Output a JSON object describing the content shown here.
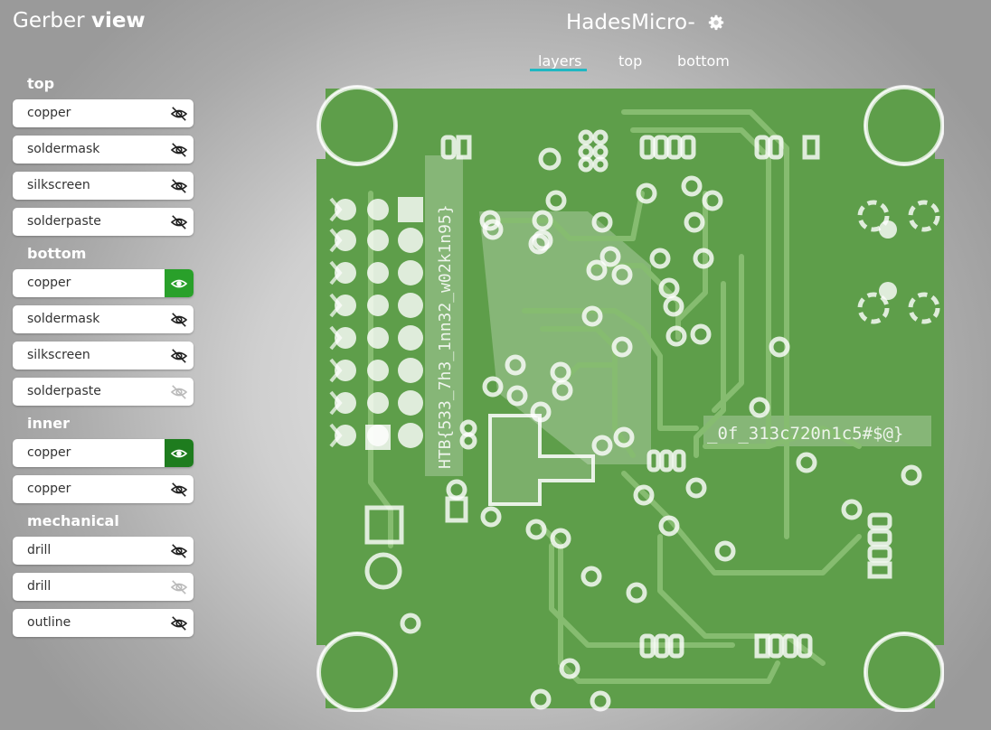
{
  "app_title": {
    "normal": "Gerber ",
    "bold": "view"
  },
  "project": {
    "name": "HadesMicro-"
  },
  "tabs": [
    {
      "label": "layers",
      "active": true
    },
    {
      "label": "top",
      "active": false
    },
    {
      "label": "bottom",
      "active": false
    }
  ],
  "sections": [
    {
      "label": "top",
      "layers": [
        {
          "label": "copper",
          "visible": false
        },
        {
          "label": "soldermask",
          "visible": false
        },
        {
          "label": "silkscreen",
          "visible": false
        },
        {
          "label": "solderpaste",
          "visible": false
        }
      ]
    },
    {
      "label": "bottom",
      "layers": [
        {
          "label": "copper",
          "visible": true
        },
        {
          "label": "soldermask",
          "visible": false
        },
        {
          "label": "silkscreen",
          "visible": false
        },
        {
          "label": "solderpaste",
          "visible": false
        }
      ]
    },
    {
      "label": "inner",
      "layers": [
        {
          "label": "copper",
          "visible": true
        },
        {
          "label": "copper",
          "visible": false
        }
      ]
    },
    {
      "label": "mechanical",
      "layers": [
        {
          "label": "drill",
          "visible": false
        },
        {
          "label": "drill",
          "visible": false
        },
        {
          "label": "outline",
          "visible": false
        }
      ]
    }
  ],
  "board": {
    "silk_text_vertical": "HTB{533_7h3_1nn32_w02k1n95}",
    "silk_text_horizontal": "_0f_313c720n1c5#$@}",
    "colors": {
      "board": "#5e9e4a",
      "copper": "#7bb266",
      "accent": "#1fb7c2",
      "eye_on": "#29a02a",
      "eye_on_dark": "#1e7c1e"
    }
  }
}
